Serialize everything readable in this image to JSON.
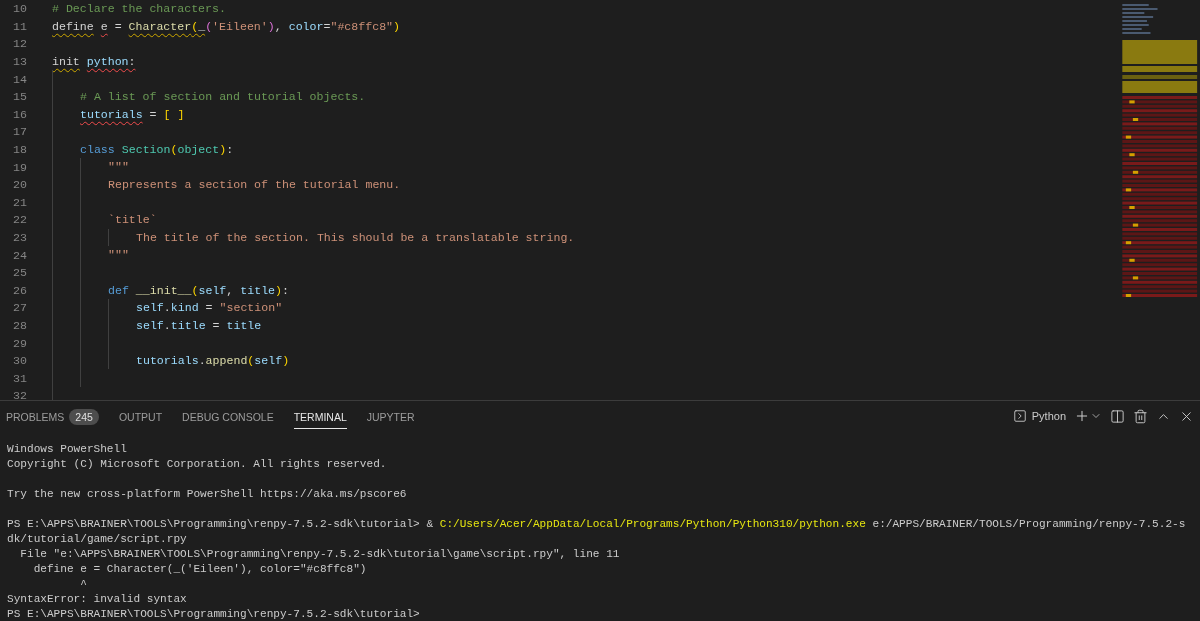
{
  "editor": {
    "lines": [
      {
        "number": "10",
        "tokens": [
          {
            "text": "# Declare the characters.",
            "kind": "comment"
          }
        ]
      },
      {
        "number": "11",
        "tokens": [
          {
            "text": "define",
            "kind": "plain",
            "warning": true,
            "space": true
          },
          {
            "text": "e",
            "kind": "plain",
            "error": true
          },
          {
            "text": " = ",
            "kind": "plain"
          },
          {
            "text": "Character",
            "kind": "function",
            "warning": true
          },
          {
            "text": "(",
            "kind": "bracket",
            "warning": true
          },
          {
            "text": "_",
            "kind": "plain",
            "warning": true
          },
          {
            "text": "(",
            "kind": "bracket2"
          },
          {
            "text": "'Eileen'",
            "kind": "string"
          },
          {
            "text": ")",
            "kind": "bracket2"
          },
          {
            "text": ",",
            "kind": "plain",
            "space": true
          },
          {
            "text": "color",
            "kind": "variable"
          },
          {
            "text": "=",
            "kind": "plain"
          },
          {
            "text": "\"#c8ffc8\"",
            "kind": "string"
          },
          {
            "text": ")",
            "kind": "bracket"
          }
        ]
      },
      {
        "number": "12"
      },
      {
        "number": "13",
        "tokens": [
          {
            "text": "init",
            "kind": "plain",
            "warning": true,
            "space": true
          },
          {
            "text": "python",
            "kind": "variable",
            "error": true
          },
          {
            "text": ":",
            "kind": "plain",
            "error": true
          }
        ],
        "children": [
          {
            "number": "14"
          },
          {
            "number": "15",
            "tokens": [
              {
                "text": "# A list of section and tutorial objects.",
                "kind": "comment"
              }
            ]
          },
          {
            "number": "16",
            "tokens": [
              {
                "text": "tutorials",
                "kind": "variable",
                "error": true
              },
              {
                "text": " = ",
                "kind": "plain"
              },
              {
                "text": "[ ]",
                "kind": "bracket"
              }
            ]
          },
          {
            "number": "17"
          },
          {
            "number": "18",
            "tokens": [
              {
                "text": "class",
                "kind": "keyword",
                "space": true
              },
              {
                "text": "Section",
                "kind": "class"
              },
              {
                "text": "(",
                "kind": "bracket"
              },
              {
                "text": "object",
                "kind": "class"
              },
              {
                "text": ")",
                "kind": "bracket"
              },
              {
                "text": ":",
                "kind": "plain"
              }
            ],
            "children": [
              {
                "number": "19",
                "tokens": [
                  {
                    "text": "\"\"\"",
                    "kind": "string"
                  }
                ]
              },
              {
                "number": "20",
                "tokens": [
                  {
                    "text": "Represents a section of the tutorial menu.",
                    "kind": "string"
                  }
                ]
              },
              {
                "number": "21"
              },
              {
                "number": "22",
                "tokens": [
                  {
                    "text": "`title`",
                    "kind": "string"
                  }
                ],
                "children": [
                  {
                    "number": "23",
                    "tokens": [
                      {
                        "text": "The title of the section. This should be a translatable string.",
                        "kind": "string"
                      }
                    ]
                  }
                ]
              },
              {
                "number": "24",
                "tokens": [
                  {
                    "text": "\"\"\"",
                    "kind": "string"
                  }
                ]
              },
              {
                "number": "25"
              },
              {
                "number": "26",
                "tokens": [
                  {
                    "text": "def",
                    "kind": "keyword",
                    "space": true
                  },
                  {
                    "text": "__init__",
                    "kind": "function"
                  },
                  {
                    "text": "(",
                    "kind": "bracket"
                  },
                  {
                    "text": "self",
                    "kind": "variable"
                  },
                  {
                    "text": ",",
                    "kind": "plain",
                    "space": true
                  },
                  {
                    "text": "title",
                    "kind": "variable"
                  },
                  {
                    "text": ")",
                    "kind": "bracket"
                  },
                  {
                    "text": ":",
                    "kind": "plain"
                  }
                ],
                "children": [
                  {
                    "number": "27",
                    "tokens": [
                      {
                        "text": "self",
                        "kind": "variable"
                      },
                      {
                        "text": ".",
                        "kind": "plain"
                      },
                      {
                        "text": "kind",
                        "kind": "variable"
                      },
                      {
                        "text": " = ",
                        "kind": "plain"
                      },
                      {
                        "text": "\"section\"",
                        "kind": "string"
                      }
                    ]
                  },
                  {
                    "number": "28",
                    "tokens": [
                      {
                        "text": "self",
                        "kind": "variable"
                      },
                      {
                        "text": ".",
                        "kind": "plain"
                      },
                      {
                        "text": "title",
                        "kind": "variable"
                      },
                      {
                        "text": " = ",
                        "kind": "plain"
                      },
                      {
                        "text": "title",
                        "kind": "variable"
                      }
                    ]
                  },
                  {
                    "number": "29"
                  },
                  {
                    "number": "30",
                    "tokens": [
                      {
                        "text": "tutorials",
                        "kind": "variable"
                      },
                      {
                        "text": ".",
                        "kind": "plain"
                      },
                      {
                        "text": "append",
                        "kind": "function"
                      },
                      {
                        "text": "(",
                        "kind": "bracket"
                      },
                      {
                        "text": "self",
                        "kind": "variable"
                      },
                      {
                        "text": ")",
                        "kind": "bracket"
                      }
                    ]
                  }
                ]
              },
              {
                "number": "31"
              }
            ]
          },
          {
            "number": "32"
          }
        ]
      }
    ]
  },
  "panel": {
    "tabs": [
      {
        "label": "PROBLEMS",
        "badge": "245",
        "selected": false
      },
      {
        "label": "OUTPUT",
        "selected": false
      },
      {
        "label": "DEBUG CONSOLE",
        "selected": false
      },
      {
        "label": "TERMINAL",
        "selected": true
      },
      {
        "label": "JUPYTER",
        "selected": false
      }
    ],
    "terminal_name": "Python",
    "terminal": [
      {
        "segments": [
          {
            "text": "Windows PowerShell",
            "kind": "plain"
          }
        ]
      },
      {
        "segments": [
          {
            "text": "Copyright (C) Microsoft Corporation. All rights reserved.",
            "kind": "plain"
          }
        ]
      },
      {
        "spaced": true,
        "segments": [
          {
            "text": "Try the new cross-platform PowerShell https://aka.ms/pscore6",
            "kind": "plain"
          }
        ]
      },
      {
        "spaced": true,
        "segments": [
          {
            "text": "PS E:\\APPS\\BRAINER\\TOOLS\\Programming\\renpy-7.5.2-sdk\\tutorial> & ",
            "kind": "plain"
          },
          {
            "text": "C:/Users/Acer/AppData/Local/Programs/Python/Python310/python.exe",
            "kind": "command"
          },
          {
            "text": " e:/APPS/BRAINER/TOOLS/Programming/renpy-7.5.2-s",
            "kind": "plain"
          }
        ]
      },
      {
        "segments": [
          {
            "text": "dk/tutorial/game/script.rpy",
            "kind": "plain"
          }
        ]
      },
      {
        "segments": [
          {
            "text": "  File \"e:\\APPS\\BRAINER\\TOOLS\\Programming\\renpy-7.5.2-sdk\\tutorial\\game\\script.rpy\", line 11",
            "kind": "plain"
          }
        ]
      },
      {
        "segments": [
          {
            "text": "    define e = Character(_('Eileen'), color=\"#c8ffc8\")",
            "kind": "plain"
          }
        ]
      },
      {
        "segments": [
          {
            "text": "           ^",
            "kind": "plain"
          }
        ]
      },
      {
        "segments": [
          {
            "text": "SyntaxError: invalid syntax",
            "kind": "plain"
          }
        ]
      },
      {
        "segments": [
          {
            "text": "PS E:\\APPS\\BRAINER\\TOOLS\\Programming\\renpy-7.5.2-sdk\\tutorial>",
            "kind": "plain"
          }
        ]
      }
    ]
  }
}
